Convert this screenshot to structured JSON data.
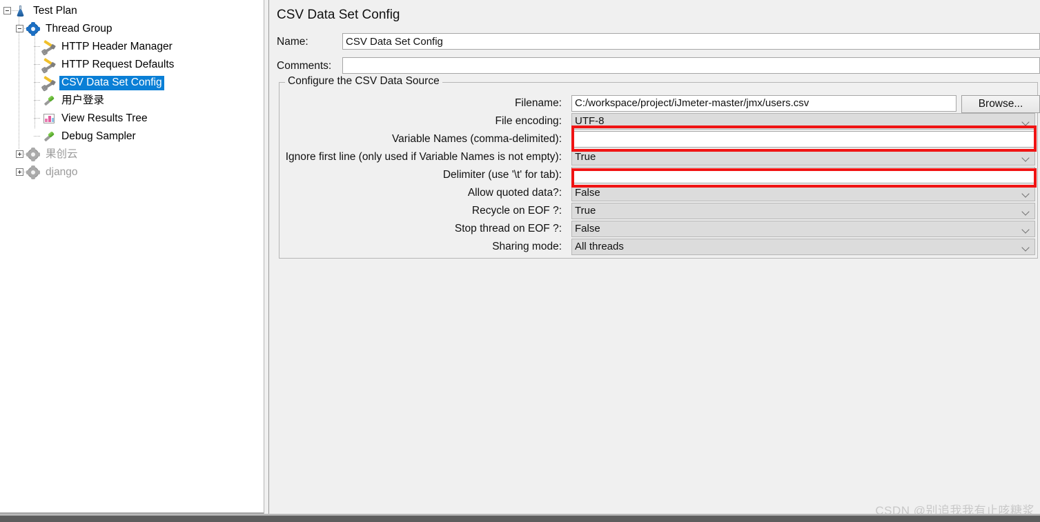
{
  "tree": {
    "items": [
      {
        "label": "Test Plan",
        "icon": "test-plan-icon",
        "indent": 0,
        "state": "expanded",
        "selected": false,
        "dim": false
      },
      {
        "label": "Thread Group",
        "icon": "thread-group-gear-icon",
        "indent": 1,
        "state": "expanded",
        "selected": false,
        "dim": false
      },
      {
        "label": "HTTP Header Manager",
        "icon": "config-tools-icon",
        "indent": 2,
        "state": "leaf",
        "selected": false,
        "dim": false
      },
      {
        "label": "HTTP Request Defaults",
        "icon": "config-tools-icon",
        "indent": 2,
        "state": "leaf",
        "selected": false,
        "dim": false
      },
      {
        "label": "CSV Data Set Config",
        "icon": "config-tools-icon",
        "indent": 2,
        "state": "leaf",
        "selected": true,
        "dim": false
      },
      {
        "label": "用户登录",
        "icon": "sampler-pipette-icon",
        "indent": 2,
        "state": "leaf",
        "selected": false,
        "dim": false
      },
      {
        "label": "View Results Tree",
        "icon": "listener-chart-icon",
        "indent": 2,
        "state": "leaf",
        "selected": false,
        "dim": false
      },
      {
        "label": "Debug Sampler",
        "icon": "sampler-pipette-icon",
        "indent": 2,
        "state": "leaf",
        "selected": false,
        "dim": false
      },
      {
        "label": "果创云",
        "icon": "thread-group-gear-icon-disabled",
        "indent": 1,
        "state": "collapsed",
        "selected": false,
        "dim": true
      },
      {
        "label": "django",
        "icon": "thread-group-gear-icon-disabled",
        "indent": 1,
        "state": "collapsed",
        "selected": false,
        "dim": true
      }
    ]
  },
  "panel": {
    "title": "CSV Data Set Config",
    "name_label": "Name:",
    "name_value": "CSV Data Set Config",
    "comments_label": "Comments:",
    "comments_value": "",
    "group_legend": "Configure the CSV Data Source",
    "browse_label": "Browse...",
    "rows": [
      {
        "label": "Filename:",
        "value": "C:/workspace/project/iJmeter-master/jmx/users.csv",
        "type": "text",
        "highlighted": false
      },
      {
        "label": "File encoding:",
        "value": "UTF-8",
        "type": "combo",
        "highlighted": false
      },
      {
        "label": "Variable Names (comma-delimited):",
        "value": "",
        "type": "text",
        "highlighted": true
      },
      {
        "label": "Ignore first line (only used if Variable Names is not empty):",
        "value": "True",
        "type": "combo",
        "highlighted": false
      },
      {
        "label": "Delimiter (use '\\t' for tab):",
        "value": "",
        "type": "text",
        "highlighted": true
      },
      {
        "label": "Allow quoted data?:",
        "value": "False",
        "type": "combo",
        "highlighted": false
      },
      {
        "label": "Recycle on EOF ?:",
        "value": "True",
        "type": "combo",
        "highlighted": false
      },
      {
        "label": "Stop thread on EOF ?:",
        "value": "False",
        "type": "combo",
        "highlighted": false
      },
      {
        "label": "Sharing mode:",
        "value": "All threads",
        "type": "combo",
        "highlighted": false
      }
    ]
  },
  "watermark": {
    "text": "CSDN @别追我我有止咳糖浆"
  },
  "colors": {
    "selection_blue": "#0a7fd6",
    "highlight_red": "#f01414",
    "panel_background": "#f0f0f0",
    "combo_background": "#dcdcdc"
  }
}
